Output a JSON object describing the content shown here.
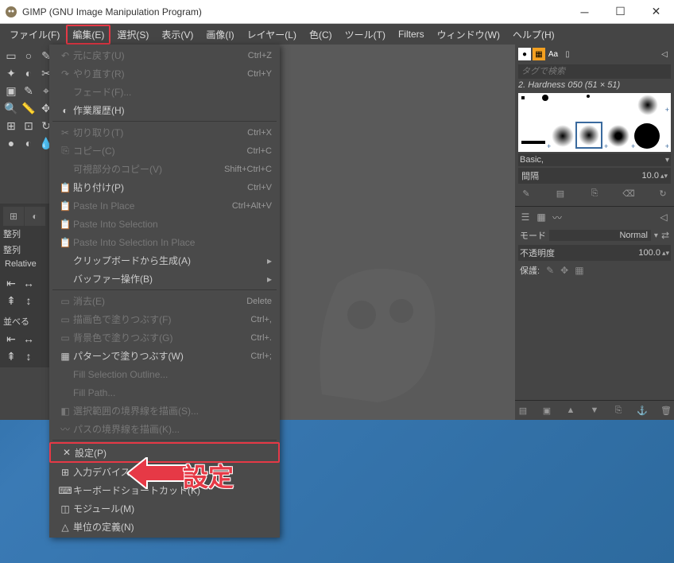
{
  "titlebar": {
    "title": "GIMP (GNU Image Manipulation Program)"
  },
  "menubar": [
    "ファイル(F)",
    "編集(E)",
    "選択(S)",
    "表示(V)",
    "画像(I)",
    "レイヤー(L)",
    "色(C)",
    "ツール(T)",
    "Filters",
    "ウィンドウ(W)",
    "ヘルプ(H)"
  ],
  "active_menu_index": 1,
  "menu": [
    {
      "label": "元に戻す(U)",
      "shortcut": "Ctrl+Z",
      "icon": "↶",
      "disabled": true
    },
    {
      "label": "やり直す(R)",
      "shortcut": "Ctrl+Y",
      "icon": "↷",
      "disabled": true
    },
    {
      "label": "フェード(F)...",
      "icon": "",
      "disabled": true
    },
    {
      "label": "作業履歴(H)",
      "icon": "◐"
    },
    {
      "sep": true
    },
    {
      "label": "切り取り(T)",
      "shortcut": "Ctrl+X",
      "icon": "✂",
      "disabled": true
    },
    {
      "label": "コピー(C)",
      "shortcut": "Ctrl+C",
      "icon": "⎘",
      "disabled": true
    },
    {
      "label": "可視部分のコピー(V)",
      "shortcut": "Shift+Ctrl+C",
      "disabled": true
    },
    {
      "label": "貼り付け(P)",
      "shortcut": "Ctrl+V",
      "icon": "📋"
    },
    {
      "label": "Paste In Place",
      "shortcut": "Ctrl+Alt+V",
      "icon": "📋",
      "disabled": true
    },
    {
      "label": "Paste Into Selection",
      "icon": "📋",
      "disabled": true
    },
    {
      "label": "Paste Into Selection In Place",
      "icon": "📋",
      "disabled": true
    },
    {
      "label": "クリップボードから生成(A)",
      "submenu": true
    },
    {
      "label": "バッファー操作(B)",
      "submenu": true
    },
    {
      "sep": true
    },
    {
      "label": "消去(E)",
      "shortcut": "Delete",
      "icon": "▭",
      "disabled": true
    },
    {
      "label": "描画色で塗りつぶす(F)",
      "shortcut": "Ctrl+,",
      "icon": "▭",
      "disabled": true
    },
    {
      "label": "背景色で塗りつぶす(G)",
      "shortcut": "Ctrl+.",
      "icon": "▭",
      "disabled": true
    },
    {
      "label": "パターンで塗りつぶす(W)",
      "shortcut": "Ctrl+;",
      "icon": "▦"
    },
    {
      "label": "Fill Selection Outline...",
      "disabled": true
    },
    {
      "label": "Fill Path...",
      "disabled": true
    },
    {
      "label": "選択範囲の境界線を描画(S)...",
      "icon": "◧",
      "disabled": true
    },
    {
      "label": "パスの境界線を描画(K)...",
      "icon": "〰",
      "disabled": true
    },
    {
      "sep": true
    },
    {
      "label": "設定(P)",
      "icon": "✕",
      "highlighted": true
    },
    {
      "label": "入力デバイスの設定(I)",
      "icon": "⊞"
    },
    {
      "label": "キーボードショートカット(K)",
      "icon": "⌨"
    },
    {
      "label": "モジュール(M)",
      "icon": "◫"
    },
    {
      "label": "単位の定義(N)",
      "icon": "△"
    }
  ],
  "annotation": "設定",
  "left_dock": {
    "sort": "整列",
    "sort2": "整列",
    "relative": "Relative",
    "arrange": "並べる"
  },
  "right_panel": {
    "search_placeholder": "タグで検索",
    "brush_name": "2. Hardness 050 (51 × 51)",
    "preset": "Basic,",
    "spacing_label": "間隔",
    "spacing_value": "10.0",
    "mode_label": "モード",
    "mode_value": "Normal",
    "opacity_label": "不透明度",
    "opacity_value": "100.0",
    "lock_label": "保護:"
  }
}
